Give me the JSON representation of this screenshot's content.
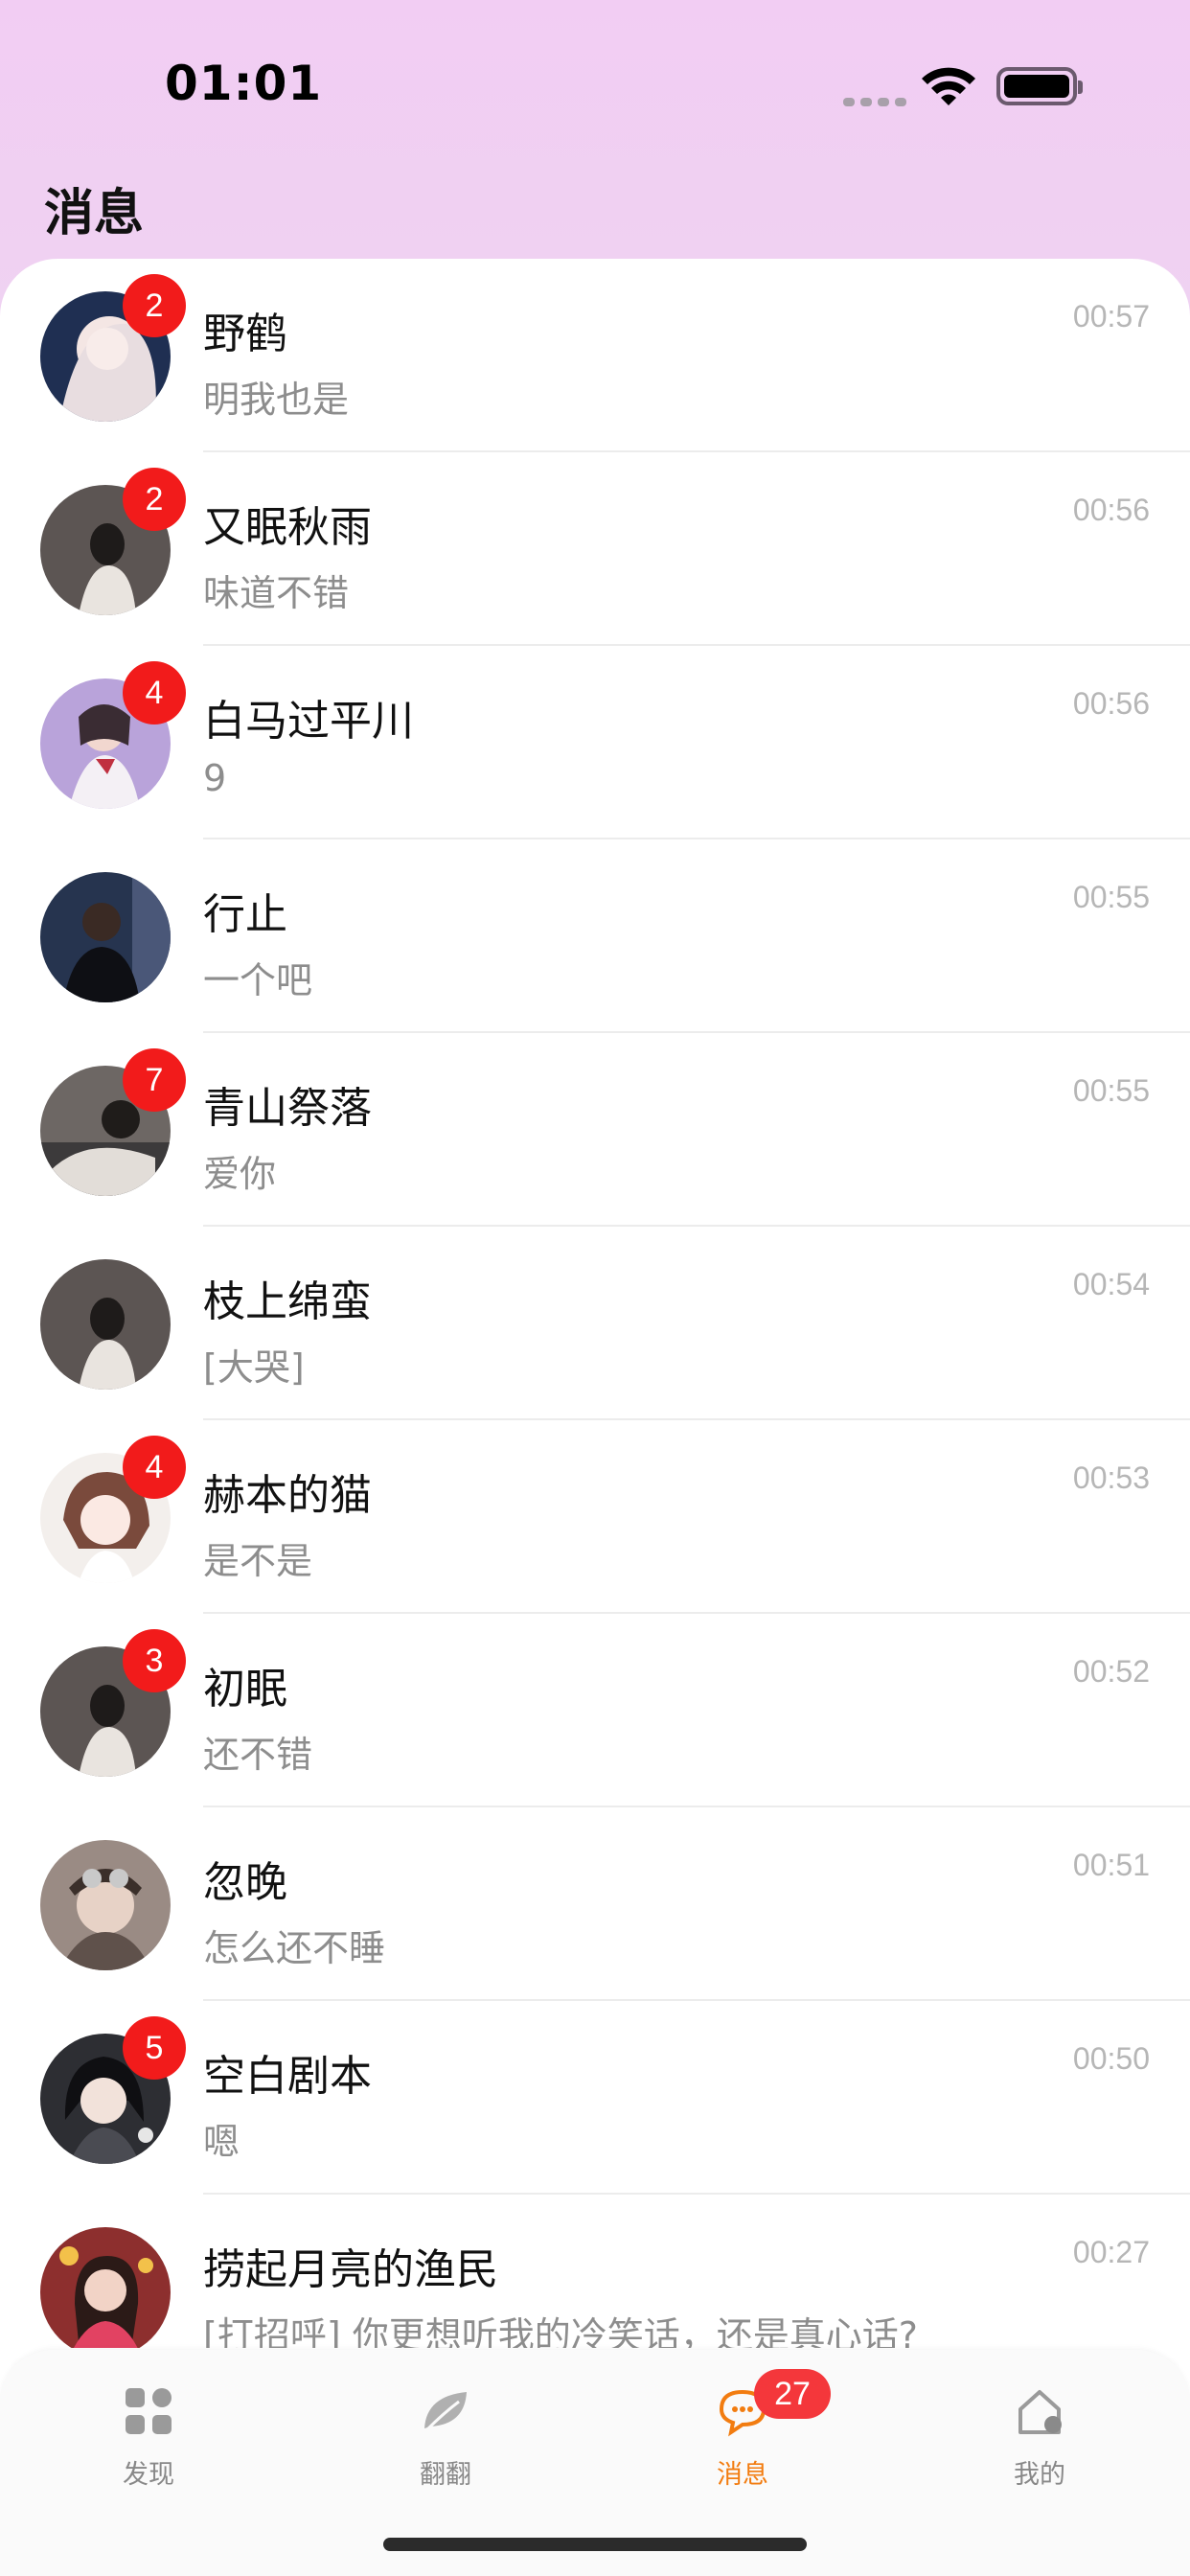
{
  "status": {
    "time": "01:01"
  },
  "header": {
    "title": "消息"
  },
  "conversations": [
    {
      "name": "野鹤",
      "message": "明我也是",
      "time": "00:57",
      "unread": "2",
      "avatar_color": "#2b3a5c"
    },
    {
      "name": "又眠秋雨",
      "message": "味道不错",
      "time": "00:56",
      "unread": "2",
      "avatar_color": "#5a5350"
    },
    {
      "name": "白马过平川",
      "message": "9",
      "time": "00:56",
      "unread": "4",
      "avatar_color": "#b9a6d8"
    },
    {
      "name": "行止",
      "message": "一个吧",
      "time": "00:55",
      "unread": "",
      "avatar_color": "#24324d"
    },
    {
      "name": "青山祭落",
      "message": "爱你",
      "time": "00:55",
      "unread": "7",
      "avatar_color": "#6a6460"
    },
    {
      "name": "枝上绵蛮",
      "message": "[大哭]",
      "time": "00:54",
      "unread": "",
      "avatar_color": "#5a5350"
    },
    {
      "name": "赫本的猫",
      "message": "是不是",
      "time": "00:53",
      "unread": "4",
      "avatar_color": "#e9e1dc"
    },
    {
      "name": "初眠",
      "message": "还不错",
      "time": "00:52",
      "unread": "3",
      "avatar_color": "#5a5350"
    },
    {
      "name": "忽晚",
      "message": "怎么还不睡",
      "time": "00:51",
      "unread": "",
      "avatar_color": "#8b7d78"
    },
    {
      "name": "空白剧本",
      "message": "嗯",
      "time": "00:50",
      "unread": "5",
      "avatar_color": "#2f2f33"
    },
    {
      "name": "捞起月亮的渔民",
      "message": "[打招呼] 你更想听我的冷笑话，还是真心话?",
      "time": "00:27",
      "unread": "",
      "avatar_color": "#b3433f"
    }
  ],
  "tabbar": {
    "tabs": [
      {
        "label": "发现",
        "icon": "discover-grid-icon"
      },
      {
        "label": "翻翻",
        "icon": "leaf-icon"
      },
      {
        "label": "消息",
        "icon": "chat-bubble-icon",
        "badge": "27",
        "active": true
      },
      {
        "label": "我的",
        "icon": "home-profile-icon"
      }
    ]
  },
  "colors": {
    "accent": "#f27c10",
    "badge": "#f21b1b",
    "header_bg": "#f2cdf3"
  }
}
